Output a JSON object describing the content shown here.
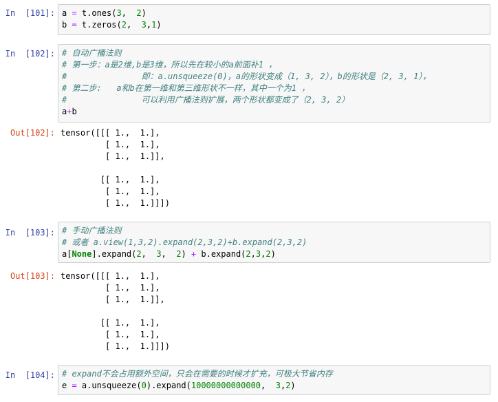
{
  "cells": [
    {
      "in_prompt": "In  [101]:",
      "lines": [
        [
          {
            "t": "a "
          },
          {
            "t": "=",
            "c": "op"
          },
          {
            "t": " t.ones("
          },
          {
            "t": "3",
            "c": "nm"
          },
          {
            "t": ",  "
          },
          {
            "t": "2",
            "c": "nm"
          },
          {
            "t": ")"
          }
        ],
        [
          {
            "t": "b "
          },
          {
            "t": "=",
            "c": "op"
          },
          {
            "t": " t.zeros("
          },
          {
            "t": "2",
            "c": "nm"
          },
          {
            "t": ",  "
          },
          {
            "t": "3",
            "c": "nm"
          },
          {
            "t": ","
          },
          {
            "t": "1",
            "c": "nm"
          },
          {
            "t": ")"
          }
        ]
      ]
    },
    {
      "in_prompt": "In  [102]:",
      "lines": [
        [
          {
            "t": "# 自动广播法则",
            "c": "cm"
          }
        ],
        [
          {
            "t": "# 第一步：a是2维,b是3维，所以先在较小的a前面补1 ，",
            "c": "cm"
          }
        ],
        [
          {
            "t": "#               即：a.unsqueeze(0)，a的形状变成（1, 3, 2），b的形状是（2, 3, 1），",
            "c": "cm"
          }
        ],
        [
          {
            "t": "# 第二步:   a和b在第一维和第三维形状不一样，其中一个为1 ，",
            "c": "cm"
          }
        ],
        [
          {
            "t": "#               可以利用广播法则扩展，两个形状都变成了（2, 3, 2）",
            "c": "cm"
          }
        ],
        [
          {
            "t": "a"
          },
          {
            "t": "+",
            "c": "op"
          },
          {
            "t": "b"
          }
        ]
      ],
      "out_prompt": "Out[102]:",
      "output": [
        "tensor([[[ 1.,  1.],",
        "         [ 1.,  1.],",
        "         [ 1.,  1.]],",
        "",
        "        [[ 1.,  1.],",
        "         [ 1.,  1.],",
        "         [ 1.,  1.]]])"
      ]
    },
    {
      "in_prompt": "In  [103]:",
      "lines": [
        [
          {
            "t": "# 手动广播法则",
            "c": "cm"
          }
        ],
        [
          {
            "t": "# 或者 a.view(1,3,2).expand(2,3,2)+b.expand(2,3,2)",
            "c": "cm"
          }
        ],
        [
          {
            "t": "a["
          },
          {
            "t": "None",
            "c": "kw"
          },
          {
            "t": "].expand("
          },
          {
            "t": "2",
            "c": "nm"
          },
          {
            "t": ",  "
          },
          {
            "t": "3",
            "c": "nm"
          },
          {
            "t": ",  "
          },
          {
            "t": "2",
            "c": "nm"
          },
          {
            "t": ") "
          },
          {
            "t": "+",
            "c": "op"
          },
          {
            "t": " b.expand("
          },
          {
            "t": "2",
            "c": "nm"
          },
          {
            "t": ","
          },
          {
            "t": "3",
            "c": "nm"
          },
          {
            "t": ","
          },
          {
            "t": "2",
            "c": "nm"
          },
          {
            "t": ")"
          }
        ]
      ],
      "out_prompt": "Out[103]:",
      "output": [
        "tensor([[[ 1.,  1.],",
        "         [ 1.,  1.],",
        "         [ 1.,  1.]],",
        "",
        "        [[ 1.,  1.],",
        "         [ 1.,  1.],",
        "         [ 1.,  1.]]])"
      ]
    },
    {
      "in_prompt": "In  [104]:",
      "lines": [
        [
          {
            "t": "# expand不会占用额外空间，只会在需要的时候才扩充，可极大节省内存",
            "c": "cm"
          }
        ],
        [
          {
            "t": "e "
          },
          {
            "t": "=",
            "c": "op"
          },
          {
            "t": " a.unsqueeze("
          },
          {
            "t": "0",
            "c": "nm"
          },
          {
            "t": ").expand("
          },
          {
            "t": "10000000000000",
            "c": "nm"
          },
          {
            "t": ",  "
          },
          {
            "t": "3",
            "c": "nm"
          },
          {
            "t": ","
          },
          {
            "t": "2",
            "c": "nm"
          },
          {
            "t": ")"
          }
        ]
      ]
    }
  ]
}
